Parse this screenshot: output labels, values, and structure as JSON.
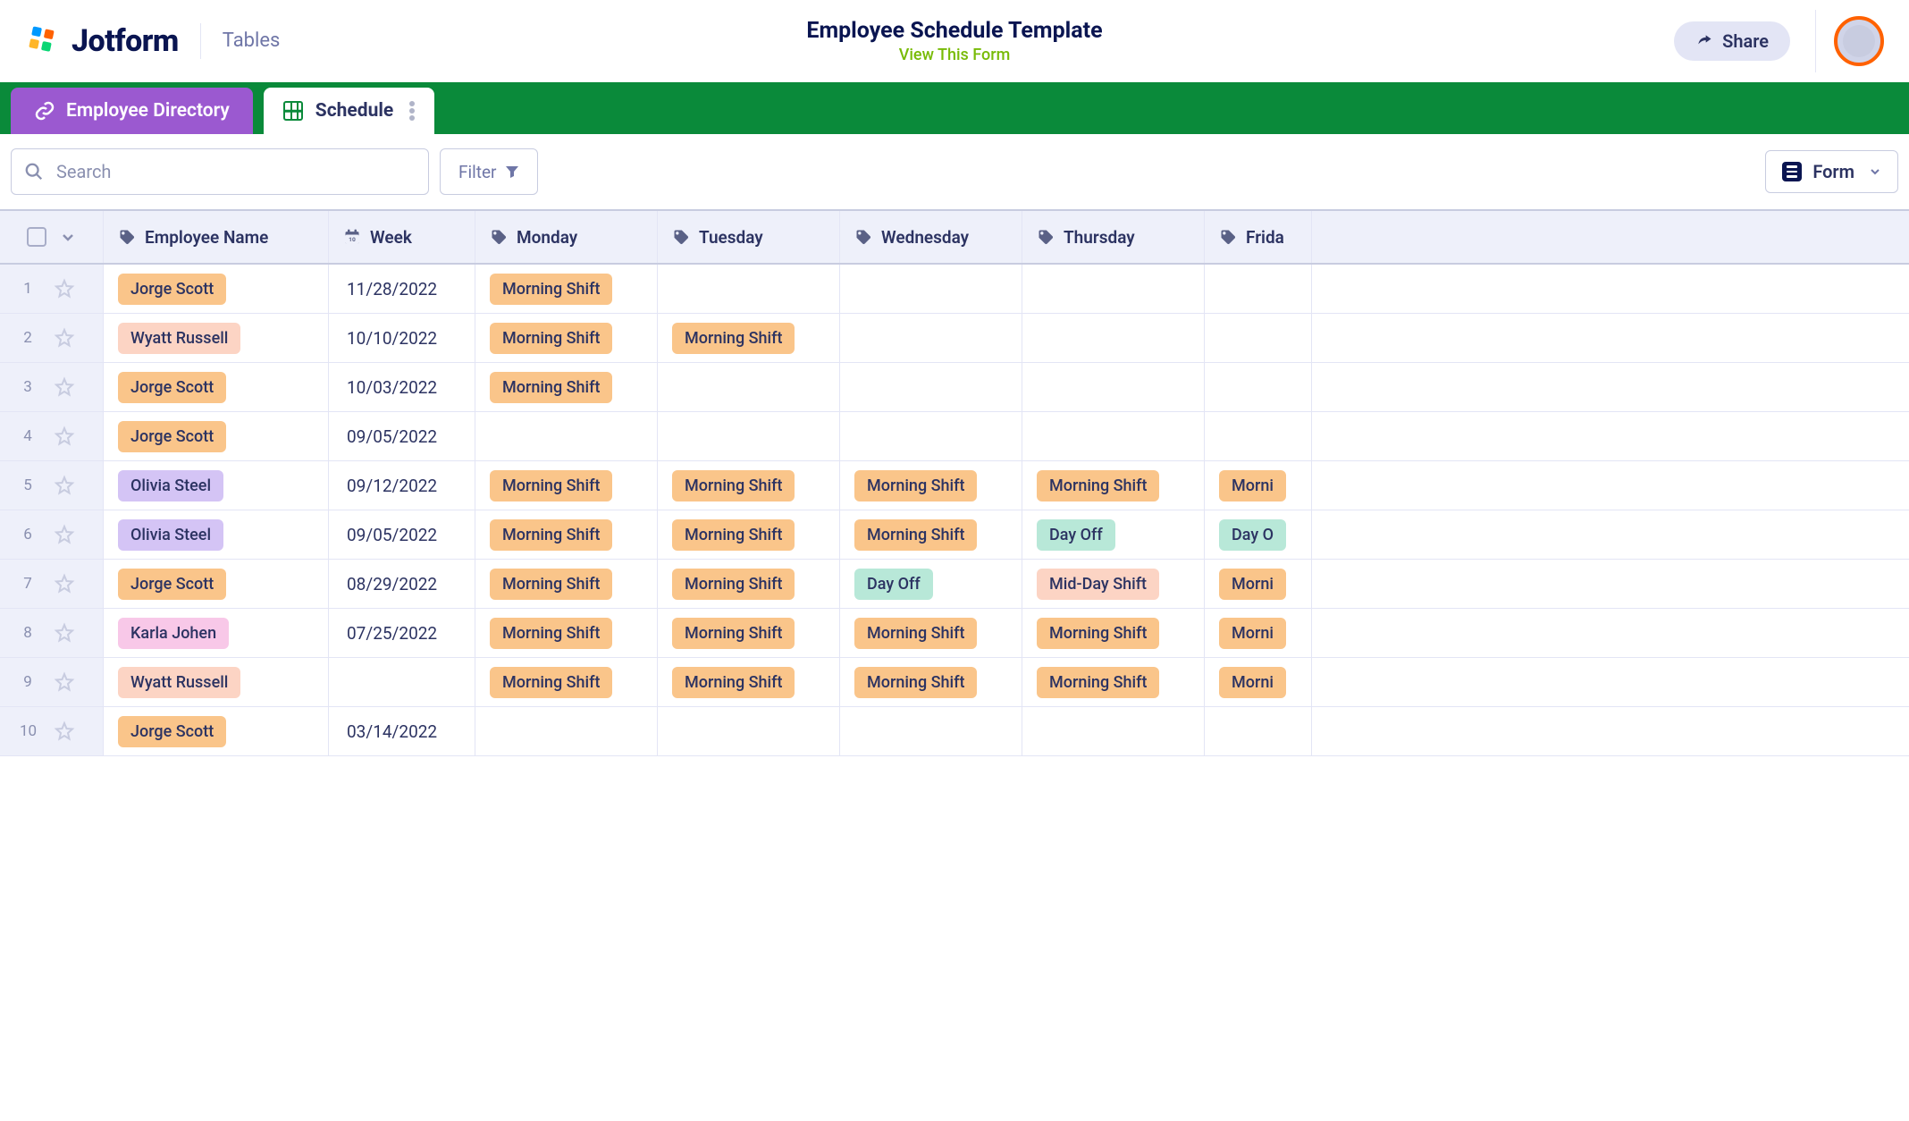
{
  "header": {
    "logo_text": "Jotform",
    "product": "Tables",
    "title": "Employee Schedule Template",
    "subtitle": "View This Form",
    "share_label": "Share"
  },
  "tabs": {
    "directory": "Employee Directory",
    "schedule": "Schedule"
  },
  "toolbar": {
    "search_placeholder": "Search",
    "filter_label": "Filter",
    "form_label": "Form"
  },
  "columns": {
    "name": "Employee Name",
    "week": "Week",
    "mon": "Monday",
    "tue": "Tuesday",
    "wed": "Wednesday",
    "thu": "Thursday",
    "fri": "Frida"
  },
  "shifts": {
    "morning": "Morning Shift",
    "midday": "Mid-Day Shift",
    "dayoff": "Day Off",
    "dayoff_cut": "Day O",
    "morning_cut": "Morni"
  },
  "rows": [
    {
      "n": "1",
      "name": "Jorge Scott",
      "name_c": "orange",
      "week": "11/28/2022",
      "mon": "morning",
      "tue": "",
      "wed": "",
      "thu": "",
      "fri": ""
    },
    {
      "n": "2",
      "name": "Wyatt Russell",
      "name_c": "peach",
      "week": "10/10/2022",
      "mon": "morning",
      "tue": "morning",
      "wed": "",
      "thu": "",
      "fri": ""
    },
    {
      "n": "3",
      "name": "Jorge Scott",
      "name_c": "orange",
      "week": "10/03/2022",
      "mon": "morning",
      "tue": "",
      "wed": "",
      "thu": "",
      "fri": ""
    },
    {
      "n": "4",
      "name": "Jorge Scott",
      "name_c": "orange",
      "week": "09/05/2022",
      "mon": "",
      "tue": "",
      "wed": "",
      "thu": "",
      "fri": ""
    },
    {
      "n": "5",
      "name": "Olivia Steel",
      "name_c": "lav",
      "week": "09/12/2022",
      "mon": "morning",
      "tue": "morning",
      "wed": "morning",
      "thu": "morning",
      "fri": "morning_cut"
    },
    {
      "n": "6",
      "name": "Olivia Steel",
      "name_c": "lav",
      "week": "09/05/2022",
      "mon": "morning",
      "tue": "morning",
      "wed": "morning",
      "thu": "dayoff",
      "fri": "dayoff_cut"
    },
    {
      "n": "7",
      "name": "Jorge Scott",
      "name_c": "orange",
      "week": "08/29/2022",
      "mon": "morning",
      "tue": "morning",
      "wed": "dayoff",
      "thu": "midday",
      "fri": "morning_cut"
    },
    {
      "n": "8",
      "name": "Karla Johen",
      "name_c": "pink",
      "week": "07/25/2022",
      "mon": "morning",
      "tue": "morning",
      "wed": "morning",
      "thu": "morning",
      "fri": "morning_cut"
    },
    {
      "n": "9",
      "name": "Wyatt Russell",
      "name_c": "peach",
      "week": "",
      "mon": "morning",
      "tue": "morning",
      "wed": "morning",
      "thu": "morning",
      "fri": "morning_cut"
    },
    {
      "n": "10",
      "name": "Jorge Scott",
      "name_c": "orange",
      "week": "03/14/2022",
      "mon": "",
      "tue": "",
      "wed": "",
      "thu": "",
      "fri": ""
    }
  ]
}
